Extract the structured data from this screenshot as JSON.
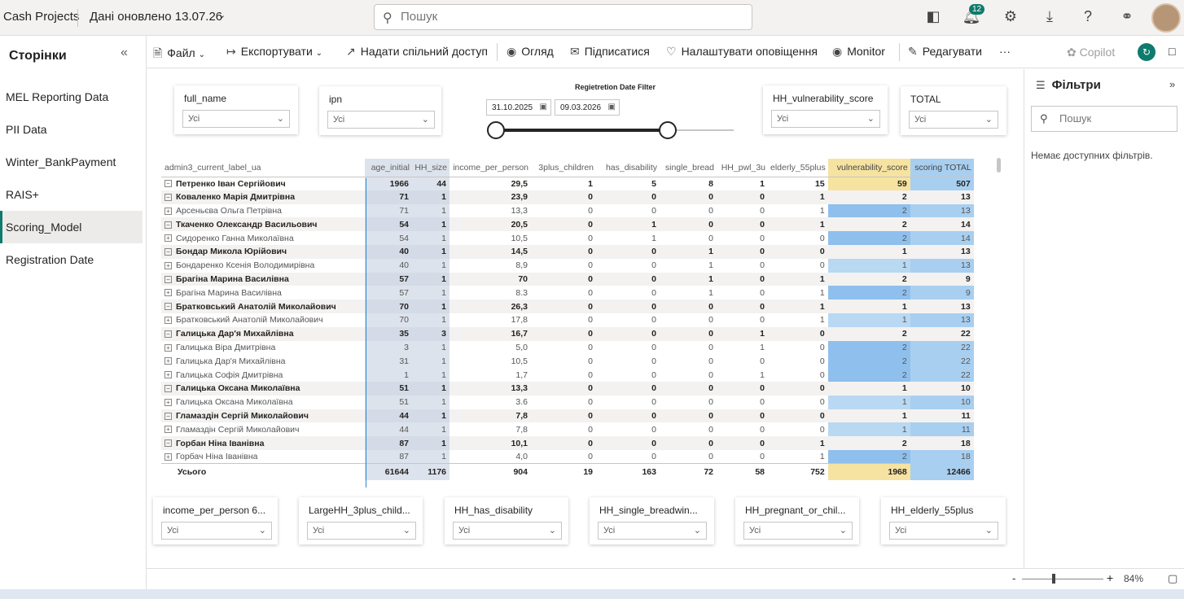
{
  "header": {
    "app_title": "Cash Projects",
    "updated": "Дані оновлено 13.07.26",
    "search_placeholder": "Пошук",
    "notification_count": "12"
  },
  "pages": {
    "title": "Сторінки",
    "items": [
      {
        "label": "MEL Reporting Data"
      },
      {
        "label": "PII Data"
      },
      {
        "label": "Winter_BankPayment"
      },
      {
        "label": "RAIS+"
      },
      {
        "label": "Scoring_Model",
        "active": true
      },
      {
        "label": "Registration Date"
      }
    ]
  },
  "toolbar": {
    "file": "Файл",
    "export": "Експортувати",
    "share": "Надати спільний доступ",
    "review": "Огляд",
    "subscribe": "Підписатися",
    "alerts": "Налаштувати оповіщення",
    "monitor": "Monitor",
    "edit": "Редагувати",
    "more": "···",
    "copilot": "Copilot"
  },
  "slicers_top": [
    {
      "label": "full_name",
      "value": "Усі"
    },
    {
      "label": "ipn",
      "value": "Усі"
    },
    {
      "label": "HH_vulnerability_score",
      "value": "Усі"
    },
    {
      "label": "TOTAL",
      "value": "Усі"
    }
  ],
  "date_filter": {
    "title": "Regietretion Date Filter",
    "start": "31.10.2025",
    "end": "09.03.2026"
  },
  "matrix": {
    "columns": [
      "admin3_current_label_ua",
      "age_initial",
      "HH_size",
      "income_per_person",
      "3plus_children",
      "has_disability",
      "single_bread",
      "HH_pwl_3u",
      "elderly_55plus",
      "vulnerability_score",
      "scoring TOTAL"
    ],
    "rows": [
      {
        "level": 0,
        "expand": "−",
        "cells": [
          "Петренко Іван Сергійович",
          "1966",
          "44",
          "29,5",
          "1",
          "5",
          "8",
          "1",
          "15",
          "59",
          "507"
        ]
      },
      {
        "level": 1,
        "expand": "−",
        "cells": [
          "Коваленко Марія Дмитрівна",
          "71",
          "1",
          "23,9",
          "0",
          "0",
          "0",
          "0",
          "1",
          "2",
          "13"
        ]
      },
      {
        "level": 2,
        "expand": "+",
        "cells": [
          "Арсеньєва Ольга Петрівна",
          "71",
          "1",
          "13,3",
          "0",
          "0",
          "0",
          "0",
          "1",
          "2",
          "13"
        ]
      },
      {
        "level": 1,
        "expand": "−",
        "cells": [
          "Ткаченко Олександр Васильович",
          "54",
          "1",
          "20,5",
          "0",
          "1",
          "0",
          "0",
          "1",
          "2",
          "14"
        ]
      },
      {
        "level": 2,
        "expand": "+",
        "cells": [
          "Сидоренко Ганна Миколаївна",
          "54",
          "1",
          "10,5",
          "0",
          "1",
          "0",
          "0",
          "0",
          "2",
          "14"
        ]
      },
      {
        "level": 1,
        "expand": "−",
        "cells": [
          "Бондар Микола Юрійович",
          "40",
          "1",
          "14,5",
          "0",
          "0",
          "1",
          "0",
          "0",
          "1",
          "13"
        ]
      },
      {
        "level": 2,
        "expand": "+",
        "cells": [
          "Бондаренко Ксенія Володимирівна",
          "40",
          "1",
          "8,9",
          "0",
          "0",
          "1",
          "0",
          "0",
          "1",
          "13"
        ]
      },
      {
        "level": 1,
        "expand": "−",
        "cells": [
          "Брагіна Марина Василівна",
          "57",
          "1",
          "70",
          "0",
          "0",
          "1",
          "0",
          "1",
          "2",
          "9"
        ]
      },
      {
        "level": 2,
        "expand": "+",
        "cells": [
          "Брагіна Марина Василівна",
          "57",
          "1",
          "8.3",
          "0",
          "0",
          "1",
          "0",
          "1",
          "2",
          "9"
        ]
      },
      {
        "level": 1,
        "expand": "−",
        "cells": [
          "Братковський Анатолій Миколайович",
          "70",
          "1",
          "26,3",
          "0",
          "0",
          "0",
          "0",
          "1",
          "1",
          "13"
        ]
      },
      {
        "level": 2,
        "expand": "+",
        "cells": [
          "Братковський Анатолій Миколайович",
          "70",
          "1",
          "17,8",
          "0",
          "0",
          "0",
          "0",
          "1",
          "1",
          "13"
        ]
      },
      {
        "level": 1,
        "expand": "−",
        "cells": [
          "Галицька Дар'я Михайлівна",
          "35",
          "3",
          "16,7",
          "0",
          "0",
          "0",
          "1",
          "0",
          "2",
          "22"
        ]
      },
      {
        "level": 2,
        "expand": "+",
        "cells": [
          "Галицька Віра Дмитрівна",
          "3",
          "1",
          "5,0",
          "0",
          "0",
          "0",
          "1",
          "0",
          "2",
          "22"
        ]
      },
      {
        "level": 2,
        "expand": "+",
        "cells": [
          "Галицька Дар'я Михайлівна",
          "31",
          "1",
          "10,5",
          "0",
          "0",
          "0",
          "0",
          "0",
          "2",
          "22"
        ]
      },
      {
        "level": 2,
        "expand": "+",
        "cells": [
          "Галицька Софія Дмитрівна",
          "1",
          "1",
          "1,7",
          "0",
          "0",
          "0",
          "1",
          "0",
          "2",
          "22"
        ]
      },
      {
        "level": 1,
        "expand": "−",
        "cells": [
          "Галицька Оксана Миколаївна",
          "51",
          "1",
          "13,3",
          "0",
          "0",
          "0",
          "0",
          "0",
          "1",
          "10"
        ]
      },
      {
        "level": 2,
        "expand": "+",
        "cells": [
          "Галицька Оксана Миколаївна",
          "51",
          "1",
          "3.6",
          "0",
          "0",
          "0",
          "0",
          "0",
          "1",
          "10"
        ]
      },
      {
        "level": 1,
        "expand": "−",
        "cells": [
          "Гламаздін Сергій Миколайович",
          "44",
          "1",
          "7,8",
          "0",
          "0",
          "0",
          "0",
          "0",
          "1",
          "11"
        ]
      },
      {
        "level": 2,
        "expand": "+",
        "cells": [
          "Гламаздін Сергій Миколайович",
          "44",
          "1",
          "7,8",
          "0",
          "0",
          "0",
          "0",
          "0",
          "1",
          "11"
        ]
      },
      {
        "level": 1,
        "expand": "−",
        "cells": [
          "Горбан Ніна Іванівна",
          "87",
          "1",
          "10,1",
          "0",
          "0",
          "0",
          "0",
          "1",
          "2",
          "18"
        ]
      },
      {
        "level": 2,
        "expand": "+",
        "cells": [
          "Горбач Ніна Іванівна",
          "87",
          "1",
          "4,0",
          "0",
          "0",
          "0",
          "0",
          "1",
          "2",
          "18"
        ]
      }
    ],
    "totals": [
      "Усього",
      "61644",
      "1176",
      "904",
      "19",
      "163",
      "72",
      "58",
      "752",
      "1968",
      "12466"
    ]
  },
  "slicers_bottom": [
    {
      "label": "income_per_person 6...",
      "value": "Усі"
    },
    {
      "label": "LargeHH_3plus_child...",
      "value": "Усі"
    },
    {
      "label": "HH_has_disability",
      "value": "Усі"
    },
    {
      "label": "HH_single_breadwin...",
      "value": "Усі"
    },
    {
      "label": "HH_pregnant_or_chil...",
      "value": "Усі"
    },
    {
      "label": "HH_elderly_55plus",
      "value": "Усі"
    }
  ],
  "filters": {
    "title": "Фільтри",
    "search_placeholder": "Пошук",
    "empty_text": "Немає доступних фільтрів."
  },
  "status": {
    "zoom": "84%"
  },
  "colors": {
    "accent": "#0f7b6c",
    "vulnerability_header": "#f6e3a1",
    "total_header": "#a8cff0"
  }
}
